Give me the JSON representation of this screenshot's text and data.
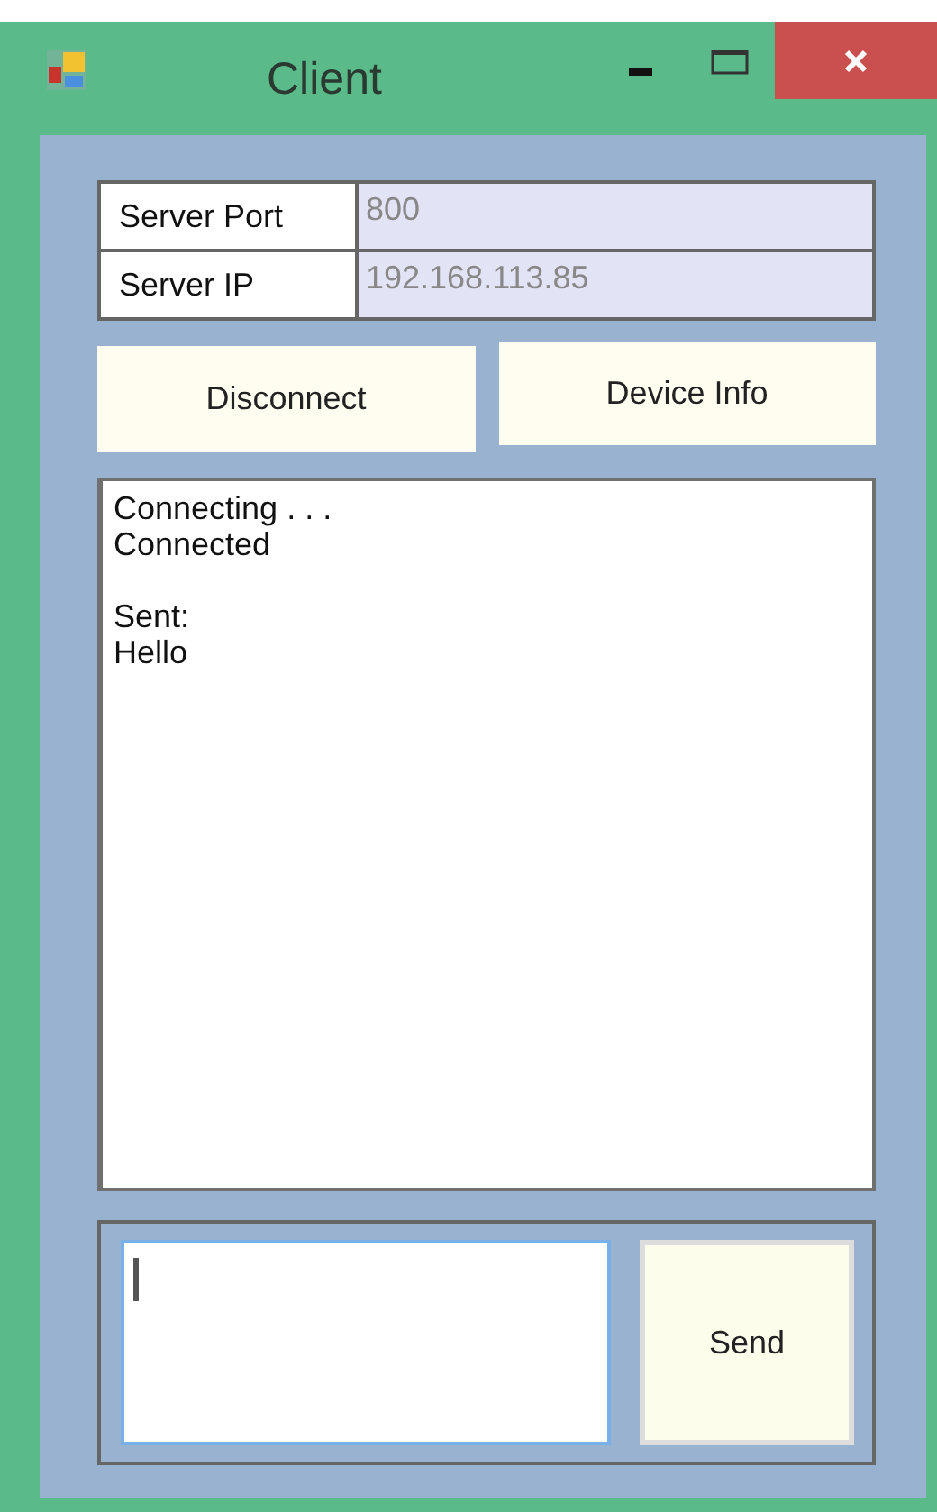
{
  "window": {
    "title": "Client"
  },
  "fields": [
    {
      "label": "Server Port",
      "value": "800",
      "disabled": true
    },
    {
      "label": "Server IP",
      "value": "192.168.113.85",
      "disabled": true
    }
  ],
  "buttons": [
    "Disconnect",
    "Device Info"
  ],
  "log": [
    [
      "Connecting . . .",
      "Connected"
    ],
    [
      "Sent:",
      "Hello"
    ]
  ],
  "message": {
    "focused": true
  },
  "send_button": "Send"
}
